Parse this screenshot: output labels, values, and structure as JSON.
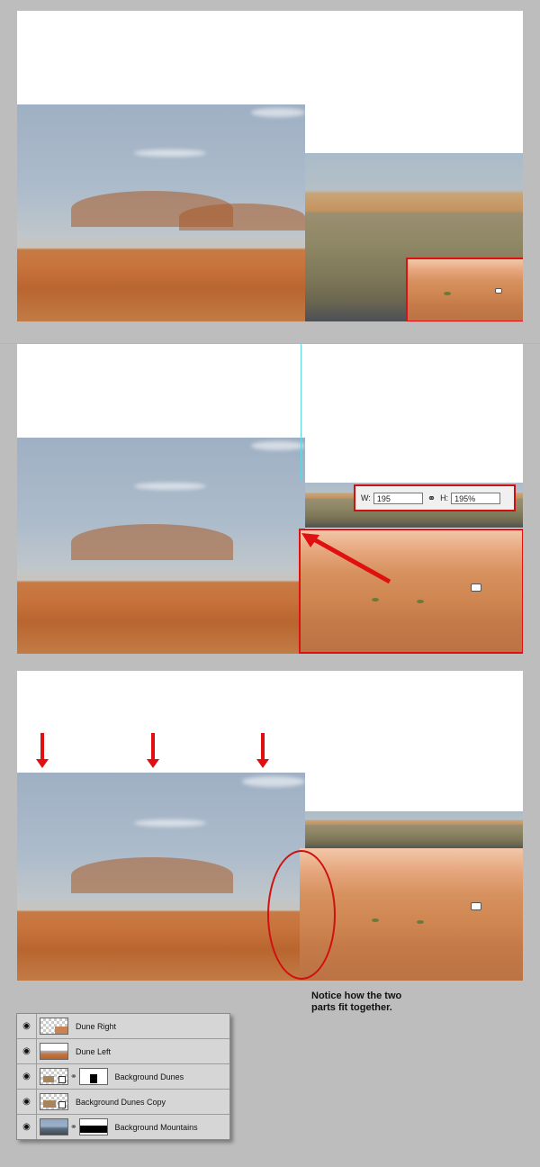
{
  "transform": {
    "w_label": "W:",
    "w_value": "195",
    "h_label": "H:",
    "h_value": "195%"
  },
  "note": {
    "line1": "Notice how the two",
    "line2": "parts fit together."
  },
  "layers": [
    {
      "name": "Dune Right"
    },
    {
      "name": "Dune Left"
    },
    {
      "name": "Background Dunes"
    },
    {
      "name": "Background Dunes Copy"
    },
    {
      "name": "Background Mountains"
    }
  ],
  "colors": {
    "highlight_red": "#e01010",
    "guide_cyan": "#5fd9e0",
    "page_background": "#bdbdbd"
  },
  "icons": [
    "eye-icon",
    "chain-link-icon",
    "smart-object-icon",
    "down-arrow-icon",
    "diagonal-arrow-icon"
  ]
}
